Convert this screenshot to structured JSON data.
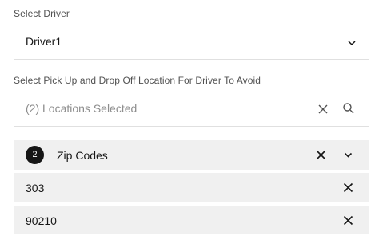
{
  "driver_select": {
    "label": "Select Driver",
    "value": "Driver1",
    "icon": "chevron-down-icon"
  },
  "location_select": {
    "label": "Select Pick Up and Drop Off Location For Driver To Avoid",
    "placeholder": "(2) Locations Selected",
    "clear_icon": "close-icon",
    "search_icon": "search-icon"
  },
  "selection_group": {
    "count": "2",
    "title": "Zip Codes",
    "items": [
      {
        "label": "303"
      },
      {
        "label": "90210"
      }
    ]
  }
}
